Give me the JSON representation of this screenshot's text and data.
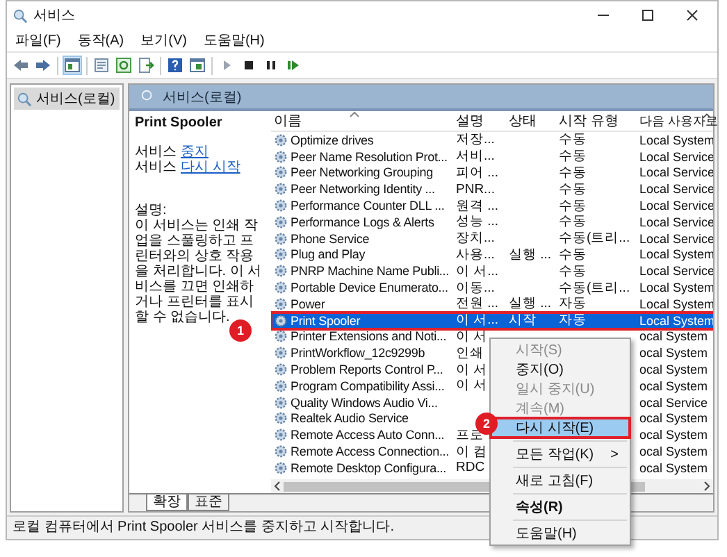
{
  "window": {
    "title": "서비스"
  },
  "menu": [
    "파일(F)",
    "동작(A)",
    "보기(V)",
    "도움말(H)"
  ],
  "tree": {
    "items": [
      {
        "label": "서비스(로컬)",
        "selected": true
      }
    ]
  },
  "panel": {
    "title": "서비스(로컬)"
  },
  "details": {
    "service_name": "Print Spooler",
    "actions": [
      {
        "prefix": "서비스",
        "link": "중지"
      },
      {
        "prefix": "서비스",
        "link": "다시 시작"
      }
    ],
    "description_label": "설명:",
    "description": "이 서비스는 인쇄 작업을 스풀링하고 프린터와의 상호 작용을 처리합니다. 이 서비스를 끄면 인쇄하거나 프린터를 표시할 수 없습니다."
  },
  "table": {
    "columns": [
      "이름",
      "설명",
      "상태",
      "시작 유형",
      "다음 사용자로"
    ],
    "rows": [
      {
        "name": "Optimize drives",
        "description": "저장...",
        "status": "",
        "startup": "수동",
        "logon": "Local System",
        "selected": false,
        "outlined": false
      },
      {
        "name": "Peer Name Resolution Prot...",
        "description": "서비...",
        "status": "",
        "startup": "수동",
        "logon": "Local Service",
        "selected": false,
        "outlined": false
      },
      {
        "name": "Peer Networking Grouping",
        "description": "피어 ...",
        "status": "",
        "startup": "수동",
        "logon": "Local Service",
        "selected": false,
        "outlined": false
      },
      {
        "name": "Peer Networking Identity ...",
        "description": "PNR...",
        "status": "",
        "startup": "수동",
        "logon": "Local Service",
        "selected": false,
        "outlined": false
      },
      {
        "name": "Performance Counter DLL ...",
        "description": "원격 ...",
        "status": "",
        "startup": "수동",
        "logon": "Local Service",
        "selected": false,
        "outlined": false
      },
      {
        "name": "Performance Logs & Alerts",
        "description": "성능 ...",
        "status": "",
        "startup": "수동",
        "logon": "Local Service",
        "selected": false,
        "outlined": false
      },
      {
        "name": "Phone Service",
        "description": "장치...",
        "status": "",
        "startup": "수동(트리...",
        "logon": "Local Service",
        "selected": false,
        "outlined": false
      },
      {
        "name": "Plug and Play",
        "description": "사용...",
        "status": "실행 ...",
        "startup": "수동",
        "logon": "Local System",
        "selected": false,
        "outlined": false
      },
      {
        "name": "PNRP Machine Name Publi...",
        "description": "이 서...",
        "status": "",
        "startup": "수동",
        "logon": "Local Service",
        "selected": false,
        "outlined": false
      },
      {
        "name": "Portable Device Enumerato...",
        "description": "이동...",
        "status": "",
        "startup": "수동(트리...",
        "logon": "Local System",
        "selected": false,
        "outlined": false
      },
      {
        "name": "Power",
        "description": "전원 ...",
        "status": "실행 ...",
        "startup": "자동",
        "logon": "Local System",
        "selected": false,
        "outlined": false
      },
      {
        "name": "Print Spooler",
        "description": "이 서...",
        "status": "시작",
        "startup": "자동",
        "logon": "Local System",
        "selected": true,
        "outlined": true
      },
      {
        "name": "Printer Extensions and Noti...",
        "description": "이 서",
        "status": "",
        "startup": "",
        "logon": "ocal System",
        "selected": false,
        "outlined": false
      },
      {
        "name": "PrintWorkflow_12c9299b",
        "description": "인쇄",
        "status": "",
        "startup": "",
        "logon": "ocal System",
        "selected": false,
        "outlined": false
      },
      {
        "name": "Problem Reports Control P...",
        "description": "이 서",
        "status": "",
        "startup": "",
        "logon": "ocal System",
        "selected": false,
        "outlined": false
      },
      {
        "name": "Program Compatibility Assi...",
        "description": "이 서",
        "status": "",
        "startup": "",
        "logon": "ocal System",
        "selected": false,
        "outlined": false
      },
      {
        "name": "Quality Windows Audio Vi...",
        "description": "",
        "status": "",
        "startup": "",
        "logon": "ocal Service",
        "selected": false,
        "outlined": false
      },
      {
        "name": "Realtek Audio Service",
        "description": "",
        "status": "",
        "startup": "",
        "logon": "ocal System",
        "selected": false,
        "outlined": false
      },
      {
        "name": "Remote Access Auto Conn...",
        "description": "프로",
        "status": "",
        "startup": "",
        "logon": "ocal System",
        "selected": false,
        "outlined": false
      },
      {
        "name": "Remote Access Connection...",
        "description": "이 컴",
        "status": "",
        "startup": "",
        "logon": "ocal System",
        "selected": false,
        "outlined": false
      },
      {
        "name": "Remote Desktop Configura...",
        "description": "RDC",
        "status": "",
        "startup": "",
        "logon": "ocal System",
        "selected": false,
        "outlined": false
      }
    ]
  },
  "context_menu": {
    "items": [
      {
        "kind": "item",
        "label": "시작(S)",
        "disabled": true,
        "selected": false,
        "bold": false,
        "outlined": false
      },
      {
        "kind": "item",
        "label": "중지(O)",
        "disabled": false,
        "selected": false,
        "bold": false,
        "outlined": false
      },
      {
        "kind": "item",
        "label": "일시 중지(U)",
        "disabled": true,
        "selected": false,
        "bold": false,
        "outlined": false
      },
      {
        "kind": "item",
        "label": "계속(M)",
        "disabled": true,
        "selected": false,
        "bold": false,
        "outlined": false
      },
      {
        "kind": "item",
        "label": "다시 시작(E)",
        "disabled": false,
        "selected": true,
        "bold": false,
        "outlined": true
      },
      {
        "kind": "separator"
      },
      {
        "kind": "submenu",
        "label": "모든 작업(K)",
        "arrow": ">",
        "disabled": false,
        "selected": false,
        "bold": false,
        "outlined": false
      },
      {
        "kind": "separator"
      },
      {
        "kind": "item",
        "label": "새로 고침(F)",
        "disabled": false,
        "selected": false,
        "bold": false,
        "outlined": false
      },
      {
        "kind": "separator"
      },
      {
        "kind": "item",
        "label": "속성(R)",
        "disabled": false,
        "selected": false,
        "bold": true,
        "outlined": false
      },
      {
        "kind": "separator"
      },
      {
        "kind": "item",
        "label": "도움말(H)",
        "disabled": false,
        "selected": false,
        "bold": false,
        "outlined": false
      }
    ]
  },
  "tabs": [
    {
      "label": "확장",
      "selected": true
    },
    {
      "label": "표준",
      "selected": false
    }
  ],
  "status_bar": "로컬 컴퓨터에서 Print Spooler 서비스를 중지하고 시작합니다.",
  "callouts": [
    "1",
    "2"
  ]
}
